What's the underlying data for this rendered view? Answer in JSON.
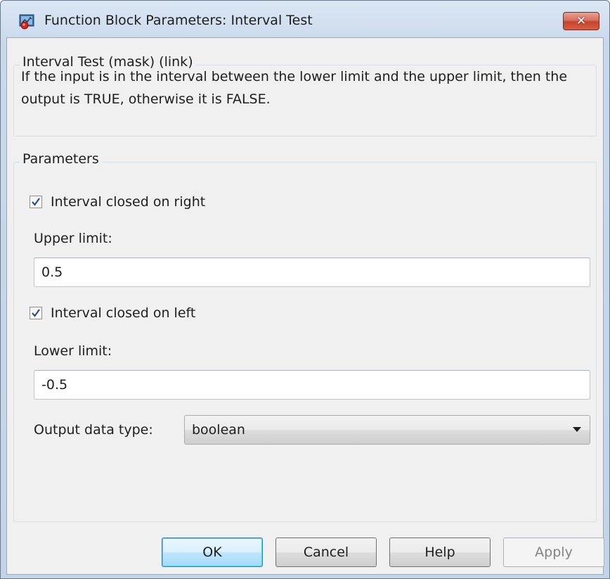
{
  "window": {
    "title": "Function Block Parameters: Interval Test",
    "close_glyph": "✕"
  },
  "mask_group": {
    "title": "Interval Test (mask) (link)",
    "description": "If the input is in the interval between the lower limit and the upper limit, then the output is TRUE, otherwise it is FALSE."
  },
  "parameters": {
    "title": "Parameters",
    "closed_right": {
      "label": "Interval closed on right",
      "checked": true
    },
    "upper_limit": {
      "label": "Upper limit:",
      "value": "0.5"
    },
    "closed_left": {
      "label": "Interval closed on left",
      "checked": true
    },
    "lower_limit": {
      "label": "Lower limit:",
      "value": "-0.5"
    },
    "output_type": {
      "label": "Output data type:",
      "value": "boolean"
    }
  },
  "buttons": {
    "ok": "OK",
    "cancel": "Cancel",
    "help": "Help",
    "apply": "Apply"
  },
  "colors": {
    "accent": "#3c7fb1",
    "close_button": "#c8442c",
    "checkmark": "#2a4f87"
  },
  "icons": {
    "app": "simulink-block-icon",
    "close": "close-icon",
    "checkbox": "checkmark-icon",
    "dropdown": "chevron-down-icon"
  }
}
